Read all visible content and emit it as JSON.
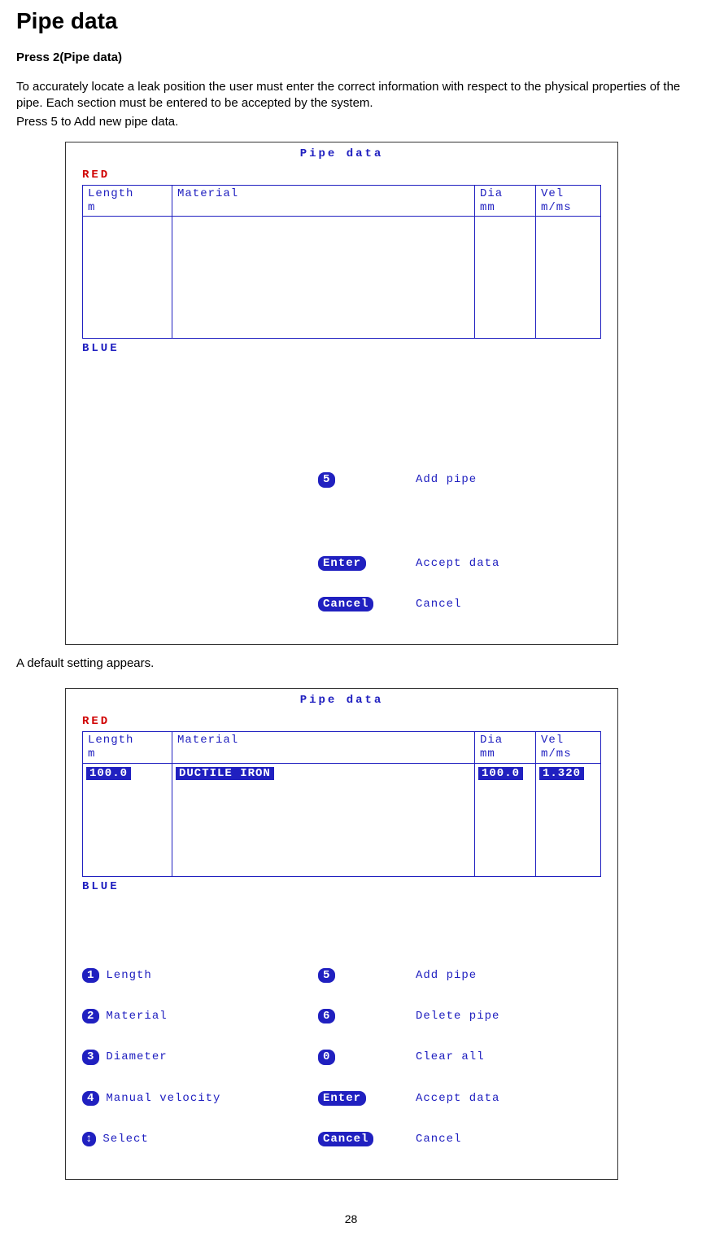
{
  "title": "Pipe data",
  "subtitle": "Press 2(Pipe data)",
  "para1": "To accurately locate a leak position the user must enter the correct information with respect to the physical properties of the pipe. Each section must be entered to be accepted by the system.",
  "para2": "Press 5 to Add new pipe data.",
  "caption": "A default setting appears.",
  "lcd": {
    "title": "Pipe data",
    "red": "RED",
    "blue": "BLUE",
    "headers": {
      "length": "Length\nm",
      "material": "Material",
      "dia": "Dia\nmm",
      "vel": "Vel\nm/ms"
    },
    "row": {
      "length": "100.0",
      "material": "DUCTILE IRON",
      "dia": "100.0",
      "vel": "1.320"
    },
    "actions1": {
      "k5": "5",
      "add_pipe": "Add pipe",
      "enter": "Enter",
      "accept": "Accept data",
      "cancel_key": "Cancel",
      "cancel": "Cancel"
    },
    "actions2": {
      "k1": "1",
      "length": "Length",
      "k2": "2",
      "material": "Material",
      "k3": "3",
      "diameter": "Diameter",
      "k4": "4",
      "manual": "Manual velocity",
      "arrow": "↕",
      "select": "Select",
      "k5": "5",
      "add_pipe": "Add pipe",
      "k6": "6",
      "delete_pipe": "Delete pipe",
      "k0": "0",
      "clear_all": "Clear all",
      "enter": "Enter",
      "accept": "Accept data",
      "cancel_key": "Cancel",
      "cancel": "Cancel"
    }
  },
  "pagenum": "28"
}
